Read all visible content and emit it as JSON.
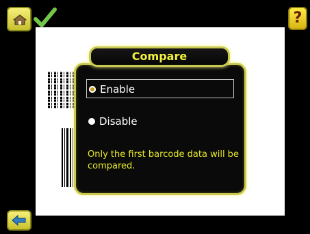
{
  "dialog": {
    "title": "Compare",
    "options": [
      {
        "label": "Enable",
        "selected": true
      },
      {
        "label": "Disable",
        "selected": false
      }
    ],
    "note": "Only the first barcode data will be compared."
  },
  "toolbar": {
    "home_icon": "home-icon",
    "status_icon": "checkmark-icon",
    "help_label": "?",
    "back_icon": "back-arrow-icon"
  },
  "colors": {
    "accent": "#c9c94f",
    "title_text": "#f2f23c",
    "note_text": "#e8ea2b"
  }
}
